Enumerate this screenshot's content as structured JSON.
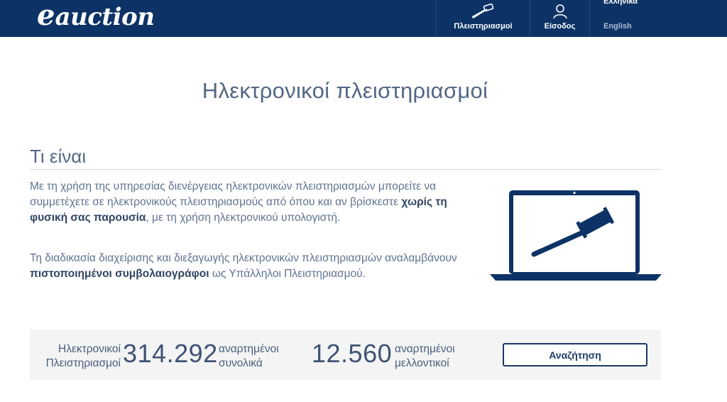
{
  "header": {
    "logo_e": "e",
    "logo_rest": "auction",
    "nav_auctions": "Πλειστηριασμοί",
    "nav_login": "Είσοδος",
    "lang_greek": "Ελληνικά",
    "lang_english": "English",
    "icons": {
      "auctions": "gavel-icon",
      "login": "user-icon"
    }
  },
  "main": {
    "title": "Ηλεκτρονικοί πλειστηριασμοί",
    "section_title": "Τι είναι",
    "para1": {
      "text_before": "Με τη χρήση της υπηρεσίας διενέργειας ηλεκτρονικών πλειστηριασμών μπορείτε να συμμετέχετε σε ηλεκτρονικούς πλειστηριασμούς από όπου και αν βρίσκεστε ",
      "bold": "χωρίς τη φυσική σας παρουσία",
      "text_after": ", με τη χρήση ηλεκτρονικού υπολογιστή."
    },
    "para2": {
      "text_before": "Τη διαδικασία διαχείρισης και διεξαγωγής ηλεκτρονικών πλειστηριασμών αναλαμβάνουν ",
      "bold": "πιστοποιημένοι συμβολαιογράφοι",
      "text_after": " ως Υπάλληλοι Πλειστηριασμού."
    },
    "illustration": "laptop-gavel-icon"
  },
  "stats": {
    "label_line1": "Ηλεκτρονικοί",
    "label_line2": "Πλειστηριασμοί",
    "total_value": "314.292",
    "total_line1": "αναρτημένοι",
    "total_line2": "συνολικά",
    "future_value": "12.560",
    "future_line1": "αναρτημένοι",
    "future_line2": "μελλοντικοί",
    "search_button": "Αναζήτηση"
  },
  "colors": {
    "brand_navy": "#0d3366",
    "text": "#5a6a80",
    "stats_bg": "#f4f4f5"
  }
}
